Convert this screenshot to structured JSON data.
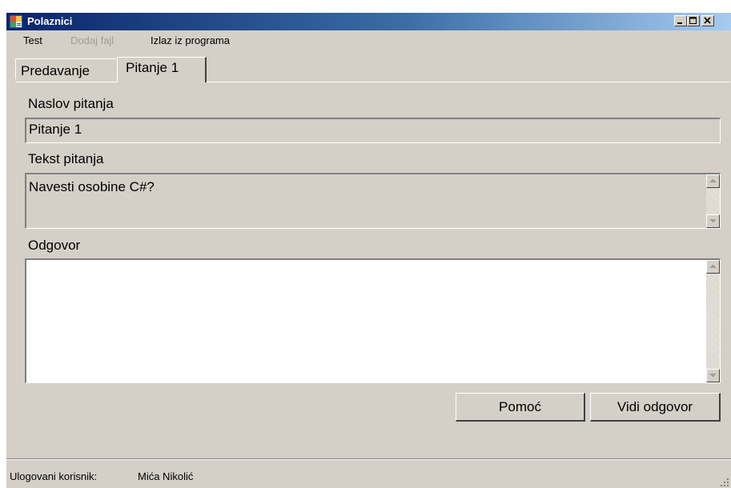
{
  "window": {
    "title": "Polaznici"
  },
  "menu": {
    "items": [
      {
        "label": "Test",
        "enabled": true
      },
      {
        "label": "Dodaj fajl",
        "enabled": false
      },
      {
        "label": "Izlaz iz programa",
        "enabled": true
      }
    ]
  },
  "tabs": [
    {
      "label": "Predavanje",
      "active": false
    },
    {
      "label": "Pitanje 1",
      "active": true
    }
  ],
  "form": {
    "title_label": "Naslov pitanja",
    "title_value": "Pitanje 1",
    "text_label": "Tekst pitanja",
    "text_value": "Navesti osobine C#?",
    "answer_label": "Odgovor",
    "answer_value": ""
  },
  "buttons": {
    "help": "Pomoć",
    "show_answer": "Vidi odgovor"
  },
  "status": {
    "label": "Ulogovani korisnik:",
    "user": "Mića Nikolić"
  },
  "colors": {
    "face": "#d4d0c8",
    "title_start": "#0a246a",
    "title_end": "#a6caf0",
    "disabled_text": "#a09d96"
  },
  "icons": {
    "app": "window-app-icon",
    "minimize": "minimize-icon",
    "maximize": "maximize-icon",
    "close": "close-icon",
    "scroll_up": "scroll-up-arrow-icon",
    "scroll_down": "scroll-down-arrow-icon",
    "grip": "resize-grip-icon"
  }
}
